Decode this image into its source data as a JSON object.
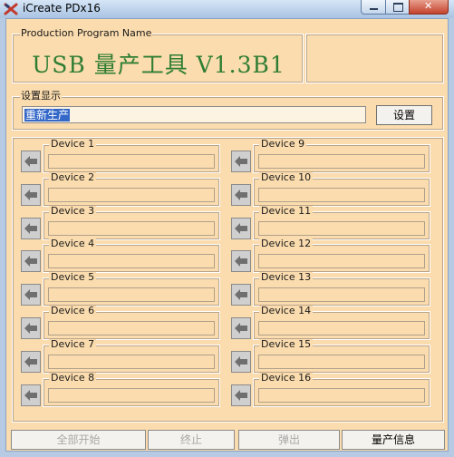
{
  "window": {
    "title": "iCreate PDx16"
  },
  "production": {
    "group_label": "Production Program Name",
    "title": "USB 量产工具 V1.3B1"
  },
  "settings": {
    "group_label": "设置显示",
    "value": "重新生产",
    "button_label": "设置"
  },
  "devices": [
    "Device 1",
    "Device 2",
    "Device 3",
    "Device 4",
    "Device 5",
    "Device 6",
    "Device 7",
    "Device 8",
    "Device 9",
    "Device 10",
    "Device 11",
    "Device 12",
    "Device 13",
    "Device 14",
    "Device 15",
    "Device 16"
  ],
  "bottom_buttons": {
    "start_all": "全部开始",
    "stop": "终止",
    "eject": "弹出",
    "production_info": "量产信息"
  },
  "colors": {
    "background": "#fbdcae",
    "title_green": "#2e7d32",
    "selection": "#3468c8"
  }
}
